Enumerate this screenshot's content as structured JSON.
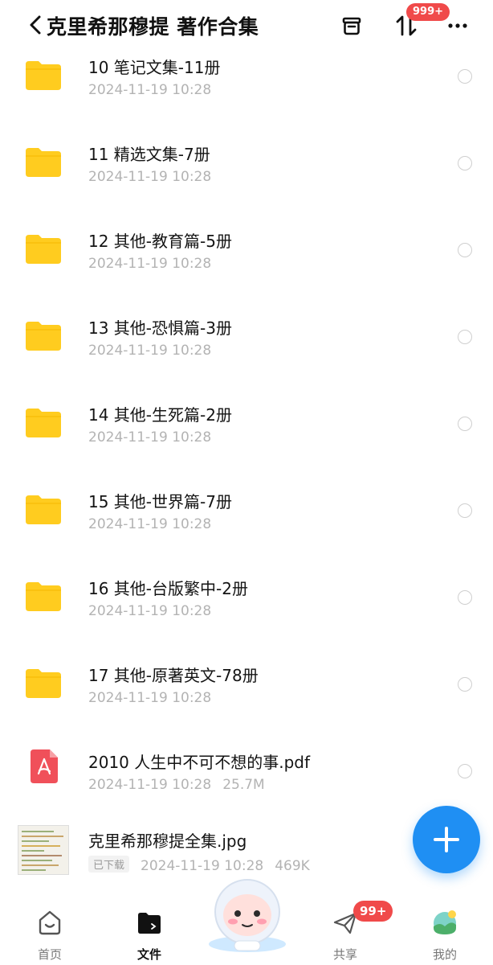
{
  "header": {
    "title": "克里希那穆提 著作合集",
    "badge": "999+"
  },
  "icons": {
    "back": "chevron-left-icon",
    "box": "archive-box-icon",
    "sort": "transfer-arrows-icon",
    "more": "more-dots-icon"
  },
  "colors": {
    "folder": "#ffcc1f",
    "accent": "#1f8ff3",
    "badge": "#f04a4a",
    "pdf": "#f0505a"
  },
  "files": [
    {
      "name": "10 笔记文集-11册",
      "date": "2024-11-19 10:28",
      "type": "folder"
    },
    {
      "name": "11 精选文集-7册",
      "date": "2024-11-19 10:28",
      "type": "folder"
    },
    {
      "name": "12 其他-教育篇-5册",
      "date": "2024-11-19 10:28",
      "type": "folder"
    },
    {
      "name": "13 其他-恐惧篇-3册",
      "date": "2024-11-19 10:28",
      "type": "folder"
    },
    {
      "name": "14 其他-生死篇-2册",
      "date": "2024-11-19 10:28",
      "type": "folder"
    },
    {
      "name": "15 其他-世界篇-7册",
      "date": "2024-11-19 10:28",
      "type": "folder"
    },
    {
      "name": "16 其他-台版繁中-2册",
      "date": "2024-11-19 10:28",
      "type": "folder"
    },
    {
      "name": "17 其他-原著英文-78册",
      "date": "2024-11-19 10:28",
      "type": "folder"
    },
    {
      "name": "2010 人生中不可不想的事.pdf",
      "date": "2024-11-19 10:28",
      "size": "25.7M",
      "type": "pdf"
    },
    {
      "name": "克里希那穆提全集.jpg",
      "date": "2024-11-19 10:28",
      "size": "469K",
      "type": "image",
      "status": "已下载"
    }
  ],
  "nav": {
    "home": "首页",
    "files": "文件",
    "share": "共享",
    "mine": "我的",
    "share_badge": "99+"
  }
}
